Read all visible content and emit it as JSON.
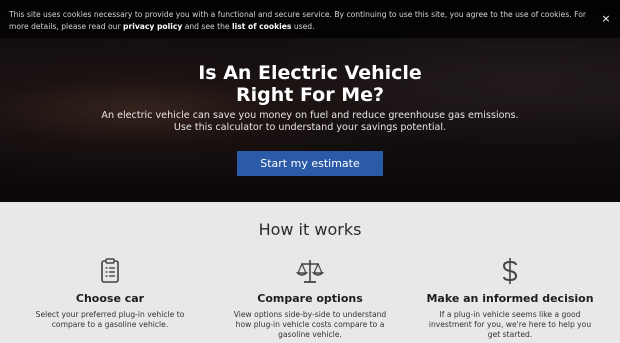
{
  "cookie_banner": {
    "text_before_policy": "This site uses cookies necessary to provide you with a functional and secure service. By continuing to use this site, you agree to the use of cookies. For more details, please read our ",
    "privacy_policy_link": "privacy policy",
    "text_between": " and see the ",
    "cookie_list_link": "list of cookies",
    "text_after": " used.",
    "close_glyph": "×"
  },
  "hero": {
    "title_line1": "Is An Electric Vehicle",
    "title_line2": "Right For Me?",
    "subtitle_line1": "An electric vehicle can save you money on fuel and reduce greenhouse gas emissions.",
    "subtitle_line2": "Use this calculator to understand your savings potential.",
    "cta_label": "Start my estimate"
  },
  "how_it_works": {
    "title": "How it works",
    "steps": [
      {
        "icon": "clipboard-icon",
        "title": "Choose car",
        "desc": "Select your preferred plug-in vehicle to compare to a gasoline vehicle."
      },
      {
        "icon": "scales-icon",
        "title": "Compare options",
        "desc": "View options side-by-side to understand how plug-in vehicle costs compare to a gasoline vehicle."
      },
      {
        "icon": "dollar-icon",
        "title": "Make an informed decision",
        "desc": "If a plug-in vehicle seems like a good investment for you, we're here to help you get started."
      }
    ]
  },
  "colors": {
    "accent": "#2b5aa8",
    "icon": "#444444",
    "section_bg": "#e8e8e8"
  }
}
